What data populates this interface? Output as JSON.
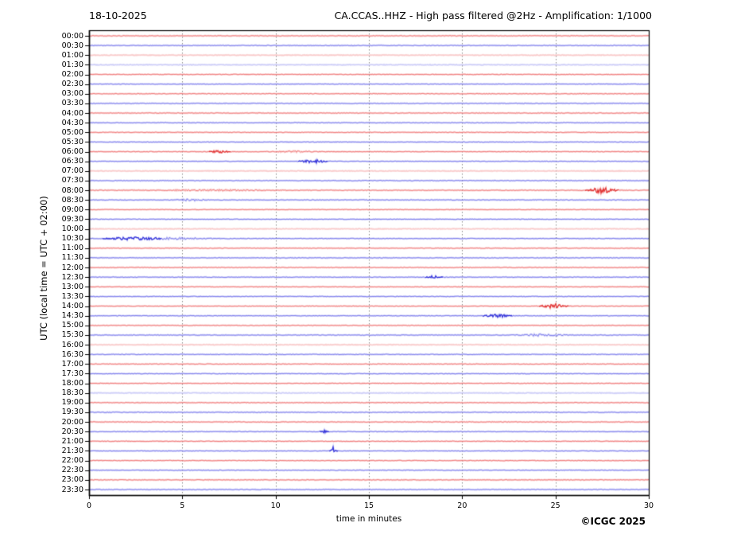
{
  "header": {
    "date": "18-10-2025",
    "title": "CA.CCAS..HHZ - High pass filtered @2Hz - Amplification: 1/1000"
  },
  "axes": {
    "y_label": "UTC (local time = UTC + 02:00)",
    "x_label": "time in minutes",
    "x_ticks": [
      0,
      5,
      10,
      15,
      20,
      25,
      30
    ],
    "x_range_minutes": [
      0,
      30
    ],
    "grid_minutes": [
      5,
      10,
      15,
      20,
      25
    ]
  },
  "footer": {
    "copyright": "©ICGC 2025"
  },
  "colors": {
    "red_trace": "#ef7272",
    "blue_trace": "#7474ea",
    "red_faint": "#f6b6b6",
    "blue_faint": "#babaf4",
    "red_dark": "#e03030",
    "blue_dark": "#3030d8",
    "grid": "#8a8a8a",
    "axis": "#000000"
  },
  "chart_data": {
    "type": "line",
    "subtype": "helicorder-seismogram",
    "minutes_per_row": 30,
    "title": "CA.CCAS..HHZ - High pass filtered @2Hz - Amplification: 1/1000",
    "xlabel": "time in minutes",
    "ylabel": "UTC (local time = UTC + 02:00)",
    "xlim": [
      0,
      30
    ],
    "grid": "vertical-dashed-every-5-min",
    "legend": "none",
    "rows": [
      {
        "label": "00:00",
        "color": "red",
        "faint": false,
        "events": []
      },
      {
        "label": "00:30",
        "color": "blue",
        "faint": false,
        "events": []
      },
      {
        "label": "01:00",
        "color": "red",
        "faint": true,
        "events": []
      },
      {
        "label": "01:30",
        "color": "blue",
        "faint": true,
        "events": []
      },
      {
        "label": "02:00",
        "color": "red",
        "faint": false,
        "events": []
      },
      {
        "label": "02:30",
        "color": "blue",
        "faint": false,
        "events": []
      },
      {
        "label": "03:00",
        "color": "red",
        "faint": false,
        "events": []
      },
      {
        "label": "03:30",
        "color": "blue",
        "faint": false,
        "events": []
      },
      {
        "label": "04:00",
        "color": "red",
        "faint": false,
        "events": []
      },
      {
        "label": "04:30",
        "color": "blue",
        "faint": false,
        "events": []
      },
      {
        "label": "05:00",
        "color": "red",
        "faint": false,
        "events": []
      },
      {
        "label": "05:30",
        "color": "blue",
        "faint": false,
        "events": []
      },
      {
        "label": "06:00",
        "color": "red",
        "faint": false,
        "events": [
          {
            "t": 7.0,
            "w": 0.5,
            "amp": 1.6
          },
          {
            "t": 11.1,
            "w": 1.2,
            "amp": 0.8
          }
        ]
      },
      {
        "label": "06:30",
        "color": "blue",
        "faint": false,
        "events": [
          {
            "t": 12.0,
            "w": 0.7,
            "amp": 2.2
          }
        ]
      },
      {
        "label": "07:00",
        "color": "red",
        "faint": true,
        "events": []
      },
      {
        "label": "07:30",
        "color": "blue",
        "faint": false,
        "events": []
      },
      {
        "label": "08:00",
        "color": "red",
        "faint": false,
        "events": [
          {
            "t": 6.5,
            "w": 3.5,
            "amp": 0.7
          },
          {
            "t": 27.5,
            "w": 0.8,
            "amp": 3.5
          }
        ]
      },
      {
        "label": "08:30",
        "color": "blue",
        "faint": false,
        "events": [
          {
            "t": 5.5,
            "w": 1.0,
            "amp": 0.9
          }
        ]
      },
      {
        "label": "09:00",
        "color": "red",
        "faint": false,
        "events": []
      },
      {
        "label": "09:30",
        "color": "blue",
        "faint": false,
        "events": []
      },
      {
        "label": "10:00",
        "color": "red",
        "faint": true,
        "events": []
      },
      {
        "label": "10:30",
        "color": "blue",
        "faint": false,
        "events": [
          {
            "t": 2.3,
            "w": 1.4,
            "amp": 1.8
          },
          {
            "t": 4.5,
            "w": 2.2,
            "amp": 0.9
          }
        ]
      },
      {
        "label": "11:00",
        "color": "red",
        "faint": false,
        "events": []
      },
      {
        "label": "11:30",
        "color": "blue",
        "faint": false,
        "events": []
      },
      {
        "label": "12:00",
        "color": "red",
        "faint": false,
        "events": []
      },
      {
        "label": "12:30",
        "color": "blue",
        "faint": false,
        "events": [
          {
            "t": 18.5,
            "w": 0.4,
            "amp": 1.6
          }
        ]
      },
      {
        "label": "13:00",
        "color": "red",
        "faint": false,
        "events": []
      },
      {
        "label": "13:30",
        "color": "blue",
        "faint": false,
        "events": []
      },
      {
        "label": "14:00",
        "color": "red",
        "faint": false,
        "events": [
          {
            "t": 24.9,
            "w": 0.7,
            "amp": 3.2
          }
        ]
      },
      {
        "label": "14:30",
        "color": "blue",
        "faint": false,
        "events": [
          {
            "t": 21.9,
            "w": 0.7,
            "amp": 1.9
          }
        ]
      },
      {
        "label": "15:00",
        "color": "red",
        "faint": false,
        "events": []
      },
      {
        "label": "15:30",
        "color": "blue",
        "faint": false,
        "events": [
          {
            "t": 24.3,
            "w": 1.3,
            "amp": 1.1
          }
        ]
      },
      {
        "label": "16:00",
        "color": "red",
        "faint": true,
        "events": []
      },
      {
        "label": "16:30",
        "color": "blue",
        "faint": false,
        "events": []
      },
      {
        "label": "17:00",
        "color": "red",
        "faint": false,
        "events": []
      },
      {
        "label": "17:30",
        "color": "blue",
        "faint": false,
        "events": []
      },
      {
        "label": "18:00",
        "color": "red",
        "faint": false,
        "events": []
      },
      {
        "label": "18:30",
        "color": "blue",
        "faint": true,
        "events": []
      },
      {
        "label": "19:00",
        "color": "red",
        "faint": false,
        "events": []
      },
      {
        "label": "19:30",
        "color": "blue",
        "faint": false,
        "events": []
      },
      {
        "label": "20:00",
        "color": "red",
        "faint": false,
        "events": []
      },
      {
        "label": "20:30",
        "color": "blue",
        "faint": false,
        "events": [
          {
            "t": 12.6,
            "w": 0.22,
            "amp": 1.6
          }
        ]
      },
      {
        "label": "21:00",
        "color": "red",
        "faint": false,
        "events": []
      },
      {
        "label": "21:30",
        "color": "blue",
        "faint": false,
        "events": [
          {
            "t": 13.1,
            "w": 0.18,
            "amp": 5.0
          }
        ]
      },
      {
        "label": "22:00",
        "color": "red",
        "faint": false,
        "events": []
      },
      {
        "label": "22:30",
        "color": "blue",
        "faint": false,
        "events": []
      },
      {
        "label": "23:00",
        "color": "red",
        "faint": false,
        "events": []
      },
      {
        "label": "23:30",
        "color": "blue",
        "faint": false,
        "events": []
      }
    ]
  }
}
